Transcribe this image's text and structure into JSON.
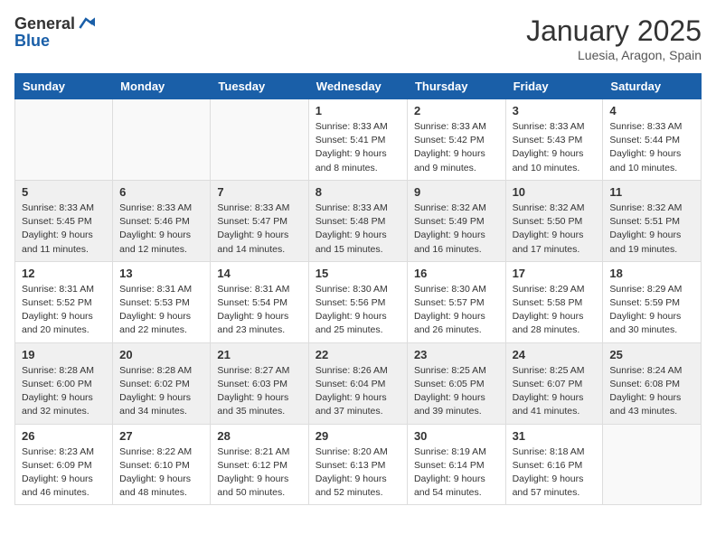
{
  "header": {
    "logo_general": "General",
    "logo_blue": "Blue",
    "month_year": "January 2025",
    "location": "Luesia, Aragon, Spain"
  },
  "weekdays": [
    "Sunday",
    "Monday",
    "Tuesday",
    "Wednesday",
    "Thursday",
    "Friday",
    "Saturday"
  ],
  "weeks": [
    [
      {
        "day": "",
        "empty": true
      },
      {
        "day": "",
        "empty": true
      },
      {
        "day": "",
        "empty": true
      },
      {
        "day": "1",
        "sunrise": "Sunrise: 8:33 AM",
        "sunset": "Sunset: 5:41 PM",
        "daylight": "Daylight: 9 hours and 8 minutes."
      },
      {
        "day": "2",
        "sunrise": "Sunrise: 8:33 AM",
        "sunset": "Sunset: 5:42 PM",
        "daylight": "Daylight: 9 hours and 9 minutes."
      },
      {
        "day": "3",
        "sunrise": "Sunrise: 8:33 AM",
        "sunset": "Sunset: 5:43 PM",
        "daylight": "Daylight: 9 hours and 10 minutes."
      },
      {
        "day": "4",
        "sunrise": "Sunrise: 8:33 AM",
        "sunset": "Sunset: 5:44 PM",
        "daylight": "Daylight: 9 hours and 10 minutes."
      }
    ],
    [
      {
        "day": "5",
        "sunrise": "Sunrise: 8:33 AM",
        "sunset": "Sunset: 5:45 PM",
        "daylight": "Daylight: 9 hours and 11 minutes."
      },
      {
        "day": "6",
        "sunrise": "Sunrise: 8:33 AM",
        "sunset": "Sunset: 5:46 PM",
        "daylight": "Daylight: 9 hours and 12 minutes."
      },
      {
        "day": "7",
        "sunrise": "Sunrise: 8:33 AM",
        "sunset": "Sunset: 5:47 PM",
        "daylight": "Daylight: 9 hours and 14 minutes."
      },
      {
        "day": "8",
        "sunrise": "Sunrise: 8:33 AM",
        "sunset": "Sunset: 5:48 PM",
        "daylight": "Daylight: 9 hours and 15 minutes."
      },
      {
        "day": "9",
        "sunrise": "Sunrise: 8:32 AM",
        "sunset": "Sunset: 5:49 PM",
        "daylight": "Daylight: 9 hours and 16 minutes."
      },
      {
        "day": "10",
        "sunrise": "Sunrise: 8:32 AM",
        "sunset": "Sunset: 5:50 PM",
        "daylight": "Daylight: 9 hours and 17 minutes."
      },
      {
        "day": "11",
        "sunrise": "Sunrise: 8:32 AM",
        "sunset": "Sunset: 5:51 PM",
        "daylight": "Daylight: 9 hours and 19 minutes."
      }
    ],
    [
      {
        "day": "12",
        "sunrise": "Sunrise: 8:31 AM",
        "sunset": "Sunset: 5:52 PM",
        "daylight": "Daylight: 9 hours and 20 minutes."
      },
      {
        "day": "13",
        "sunrise": "Sunrise: 8:31 AM",
        "sunset": "Sunset: 5:53 PM",
        "daylight": "Daylight: 9 hours and 22 minutes."
      },
      {
        "day": "14",
        "sunrise": "Sunrise: 8:31 AM",
        "sunset": "Sunset: 5:54 PM",
        "daylight": "Daylight: 9 hours and 23 minutes."
      },
      {
        "day": "15",
        "sunrise": "Sunrise: 8:30 AM",
        "sunset": "Sunset: 5:56 PM",
        "daylight": "Daylight: 9 hours and 25 minutes."
      },
      {
        "day": "16",
        "sunrise": "Sunrise: 8:30 AM",
        "sunset": "Sunset: 5:57 PM",
        "daylight": "Daylight: 9 hours and 26 minutes."
      },
      {
        "day": "17",
        "sunrise": "Sunrise: 8:29 AM",
        "sunset": "Sunset: 5:58 PM",
        "daylight": "Daylight: 9 hours and 28 minutes."
      },
      {
        "day": "18",
        "sunrise": "Sunrise: 8:29 AM",
        "sunset": "Sunset: 5:59 PM",
        "daylight": "Daylight: 9 hours and 30 minutes."
      }
    ],
    [
      {
        "day": "19",
        "sunrise": "Sunrise: 8:28 AM",
        "sunset": "Sunset: 6:00 PM",
        "daylight": "Daylight: 9 hours and 32 minutes."
      },
      {
        "day": "20",
        "sunrise": "Sunrise: 8:28 AM",
        "sunset": "Sunset: 6:02 PM",
        "daylight": "Daylight: 9 hours and 34 minutes."
      },
      {
        "day": "21",
        "sunrise": "Sunrise: 8:27 AM",
        "sunset": "Sunset: 6:03 PM",
        "daylight": "Daylight: 9 hours and 35 minutes."
      },
      {
        "day": "22",
        "sunrise": "Sunrise: 8:26 AM",
        "sunset": "Sunset: 6:04 PM",
        "daylight": "Daylight: 9 hours and 37 minutes."
      },
      {
        "day": "23",
        "sunrise": "Sunrise: 8:25 AM",
        "sunset": "Sunset: 6:05 PM",
        "daylight": "Daylight: 9 hours and 39 minutes."
      },
      {
        "day": "24",
        "sunrise": "Sunrise: 8:25 AM",
        "sunset": "Sunset: 6:07 PM",
        "daylight": "Daylight: 9 hours and 41 minutes."
      },
      {
        "day": "25",
        "sunrise": "Sunrise: 8:24 AM",
        "sunset": "Sunset: 6:08 PM",
        "daylight": "Daylight: 9 hours and 43 minutes."
      }
    ],
    [
      {
        "day": "26",
        "sunrise": "Sunrise: 8:23 AM",
        "sunset": "Sunset: 6:09 PM",
        "daylight": "Daylight: 9 hours and 46 minutes."
      },
      {
        "day": "27",
        "sunrise": "Sunrise: 8:22 AM",
        "sunset": "Sunset: 6:10 PM",
        "daylight": "Daylight: 9 hours and 48 minutes."
      },
      {
        "day": "28",
        "sunrise": "Sunrise: 8:21 AM",
        "sunset": "Sunset: 6:12 PM",
        "daylight": "Daylight: 9 hours and 50 minutes."
      },
      {
        "day": "29",
        "sunrise": "Sunrise: 8:20 AM",
        "sunset": "Sunset: 6:13 PM",
        "daylight": "Daylight: 9 hours and 52 minutes."
      },
      {
        "day": "30",
        "sunrise": "Sunrise: 8:19 AM",
        "sunset": "Sunset: 6:14 PM",
        "daylight": "Daylight: 9 hours and 54 minutes."
      },
      {
        "day": "31",
        "sunrise": "Sunrise: 8:18 AM",
        "sunset": "Sunset: 6:16 PM",
        "daylight": "Daylight: 9 hours and 57 minutes."
      },
      {
        "day": "",
        "empty": true
      }
    ]
  ]
}
